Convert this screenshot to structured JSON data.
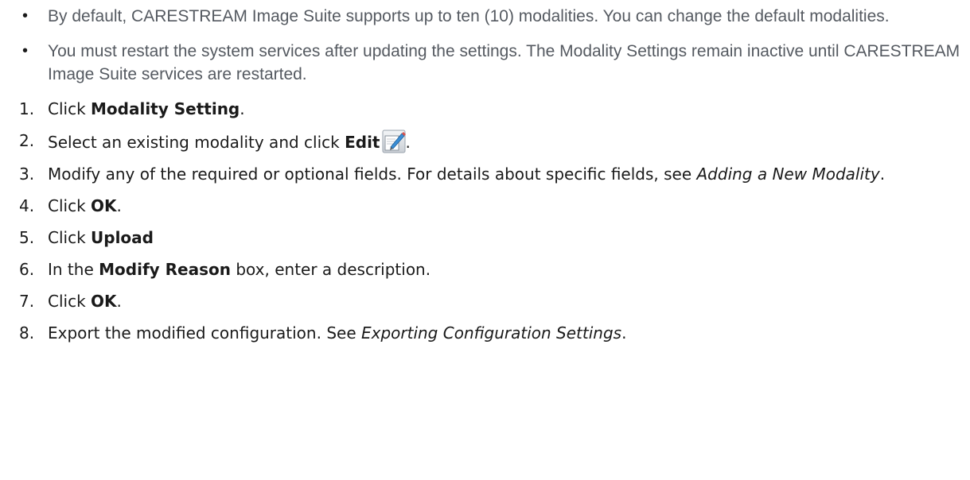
{
  "notes": [
    {
      "bullet": "•",
      "text": "By default, CARESTREAM Image Suite supports up to ten (10) modalities. You can change the default modalities."
    },
    {
      "bullet": "•",
      "text": "You must restart the system services after updating the settings. The Modality Settings remain inactive until CARESTREAM Image Suite services are restarted."
    }
  ],
  "steps": [
    {
      "num": "1.",
      "pre": "Click ",
      "bold": "Modality Setting",
      "post": "."
    },
    {
      "num": "2.",
      "pre": "Select an existing modality and click ",
      "bold": "Edit",
      "icon": "edit-pencil-icon",
      "post": "."
    },
    {
      "num": "3.",
      "pre": "Modify any of the required or optional fields. For details about specific fields, see ",
      "italic": "Adding a New Modality",
      "post": "."
    },
    {
      "num": "4.",
      "pre": "Click ",
      "bold": "OK",
      "post": "."
    },
    {
      "num": "5.",
      "pre": "Click ",
      "bold": "Upload",
      "post": ""
    },
    {
      "num": "6.",
      "pre": "In the ",
      "bold": "Modify Reason",
      "post": " box, enter a description."
    },
    {
      "num": "7.",
      "pre": "Click ",
      "bold": "OK",
      "post": "."
    },
    {
      "num": "8.",
      "pre": "Export the modified configuration. See ",
      "italic": "Exporting Configuration Settings",
      "post": "."
    }
  ]
}
